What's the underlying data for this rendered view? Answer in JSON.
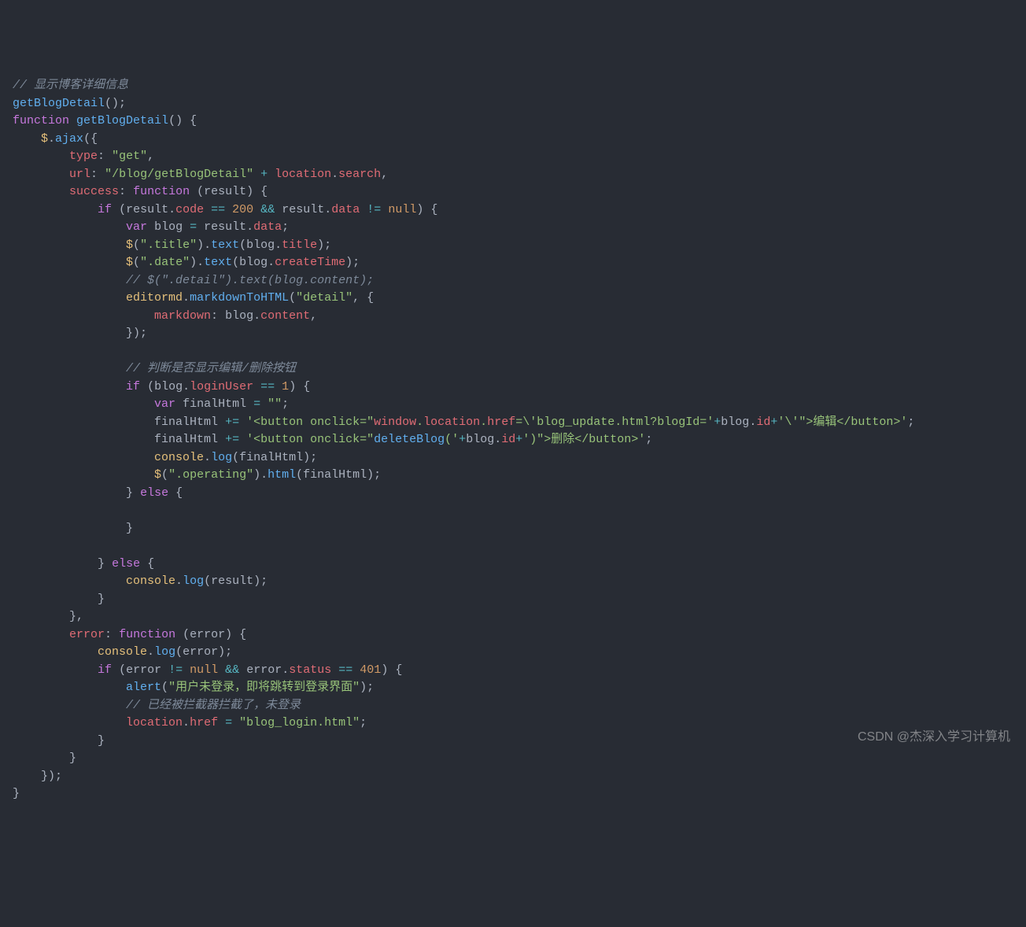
{
  "code": {
    "line1_comment": "// 显示博客详细信息",
    "line2_call": "getBlogDetail",
    "line3_function": "function",
    "line3_name": "getBlogDetail",
    "line4_jq": "$",
    "line4_ajax": "ajax",
    "line5_type": "type",
    "line5_get": "\"get\"",
    "line6_url": "url",
    "line6_path": "\"/blog/getBlogDetail\"",
    "line6_location": "location",
    "line6_search": "search",
    "line7_success": "success",
    "line7_function": "function",
    "line7_result": "result",
    "line8_if": "if",
    "line8_result": "result",
    "line8_code": "code",
    "line8_eq": "==",
    "line8_200": "200",
    "line8_and": "&&",
    "line8_data": "data",
    "line8_ne": "!=",
    "line8_null": "null",
    "line9_var": "var",
    "line9_blog": "blog",
    "line9_result": "result",
    "line9_data": "data",
    "line10_jq": "$",
    "line10_sel": "\".title\"",
    "line10_text": "text",
    "line10_blog": "blog",
    "line10_title": "title",
    "line11_jq": "$",
    "line11_sel": "\".date\"",
    "line11_text": "text",
    "line11_blog": "blog",
    "line11_ct": "createTime",
    "line12_comment": "// $(\".detail\").text(blog.content);",
    "line13_editormd": "editormd",
    "line13_mth": "markdownToHTML",
    "line13_detail": "\"detail\"",
    "line14_markdown": "markdown",
    "line14_blog": "blog",
    "line14_content": "content",
    "line16_comment": "// 判断是否显示编辑/删除按钮",
    "line17_if": "if",
    "line17_blog": "blog",
    "line17_lu": "loginUser",
    "line17_eq": "==",
    "line17_1": "1",
    "line18_var": "var",
    "line18_fh": "finalHtml",
    "line18_empty": "\"\"",
    "line19_fh": "finalHtml",
    "line19_pe": "+=",
    "line19_s1": "'<button onclick=\"",
    "line19_win": "window",
    "line19_loc": "location",
    "line19_href": "href",
    "line19_s2": "=\\'",
    "line19_s3": "blog_update.html?blogId=",
    "line19_s4": "'",
    "line19_plus": "+",
    "line19_blog": "blog",
    "line19_id": "id",
    "line19_s5": "'\\'\">编辑</button>'",
    "line20_fh": "finalHtml",
    "line20_pe": "+=",
    "line20_s1": "'<button onclick=\"",
    "line20_db": "deleteBlog",
    "line20_s2": "(",
    "line20_s3": "'",
    "line20_plus": "+",
    "line20_blog": "blog",
    "line20_id": "id",
    "line20_s4": "'",
    "line20_s5": ")\">删除</button>'",
    "line21_console": "console",
    "line21_log": "log",
    "line21_fh": "finalHtml",
    "line22_jq": "$",
    "line22_sel": "\".operating\"",
    "line22_html": "html",
    "line22_fh": "finalHtml",
    "line23_else": "else",
    "line25_else": "else",
    "line26_console": "console",
    "line26_log": "log",
    "line26_result": "result",
    "line29_error": "error",
    "line29_function": "function",
    "line29_param": "error",
    "line30_console": "console",
    "line30_log": "log",
    "line30_error": "error",
    "line31_if": "if",
    "line31_error": "error",
    "line31_ne": "!=",
    "line31_null": "null",
    "line31_and": "&&",
    "line31_status": "status",
    "line31_eq": "==",
    "line31_401": "401",
    "line32_alert": "alert",
    "line32_msg": "\"用户未登录，即将跳转到登录界面\"",
    "line33_comment": "// 已经被拦截器拦截了，未登录",
    "line34_location": "location",
    "line34_href": "href",
    "line34_url": "\"blog_login.html\""
  },
  "watermark": "CSDN @杰深入学习计算机"
}
